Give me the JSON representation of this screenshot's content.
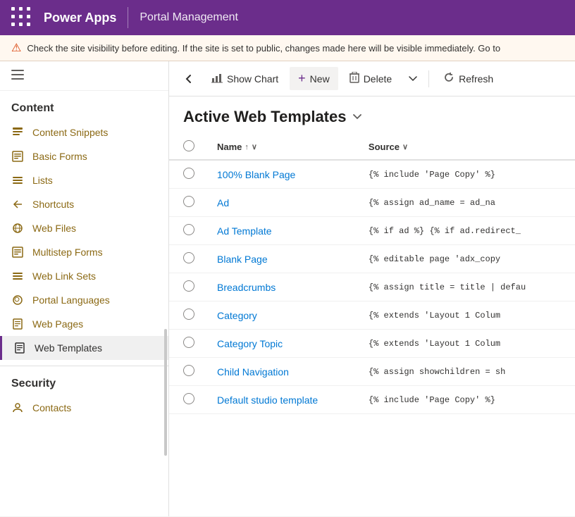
{
  "topNav": {
    "appName": "Power Apps",
    "subName": "Portal Management"
  },
  "warningBar": {
    "text": "Check the site visibility before editing. If the site is set to public, changes made here will be visible immediately. Go to"
  },
  "sidebar": {
    "contentSectionTitle": "Content",
    "items": [
      {
        "id": "content-snippets",
        "label": "Content Snippets",
        "icon": "🗒"
      },
      {
        "id": "basic-forms",
        "label": "Basic Forms",
        "icon": "📋"
      },
      {
        "id": "lists",
        "label": "Lists",
        "icon": "☰"
      },
      {
        "id": "shortcuts",
        "label": "Shortcuts",
        "icon": "↩"
      },
      {
        "id": "web-files",
        "label": "Web Files",
        "icon": "🌐"
      },
      {
        "id": "multistep-forms",
        "label": "Multistep Forms",
        "icon": "📄"
      },
      {
        "id": "web-link-sets",
        "label": "Web Link Sets",
        "icon": "≡"
      },
      {
        "id": "portal-languages",
        "label": "Portal Languages",
        "icon": "🌍"
      },
      {
        "id": "web-pages",
        "label": "Web Pages",
        "icon": "📰"
      },
      {
        "id": "web-templates",
        "label": "Web Templates",
        "icon": "📄",
        "active": true
      }
    ],
    "securitySectionTitle": "Security",
    "securityItems": [
      {
        "id": "contacts",
        "label": "Contacts",
        "icon": "👤"
      }
    ]
  },
  "toolbar": {
    "backLabel": "←",
    "showChartLabel": "Show Chart",
    "newLabel": "New",
    "deleteLabel": "Delete",
    "refreshLabel": "Refresh"
  },
  "tableTitle": "Active Web Templates",
  "table": {
    "columns": [
      {
        "id": "select",
        "label": ""
      },
      {
        "id": "name",
        "label": "Name",
        "sortable": true
      },
      {
        "id": "source",
        "label": "Source",
        "sortable": true
      }
    ],
    "rows": [
      {
        "name": "100% Blank Page",
        "source": "{% include 'Page Copy' %}"
      },
      {
        "name": "Ad",
        "source": "{% assign ad_name = ad_na"
      },
      {
        "name": "Ad Template",
        "source": "{% if ad %} {% if ad.redirect_"
      },
      {
        "name": "Blank Page",
        "source": "{% editable page 'adx_copy"
      },
      {
        "name": "Breadcrumbs",
        "source": "{% assign title = title | defau"
      },
      {
        "name": "Category",
        "source": "{% extends 'Layout 1 Colum"
      },
      {
        "name": "Category Topic",
        "source": "{% extends 'Layout 1 Colum"
      },
      {
        "name": "Child Navigation",
        "source": "{% assign showchildren = sh"
      },
      {
        "name": "Default studio template",
        "source": "{% include 'Page Copy' %}"
      }
    ]
  }
}
